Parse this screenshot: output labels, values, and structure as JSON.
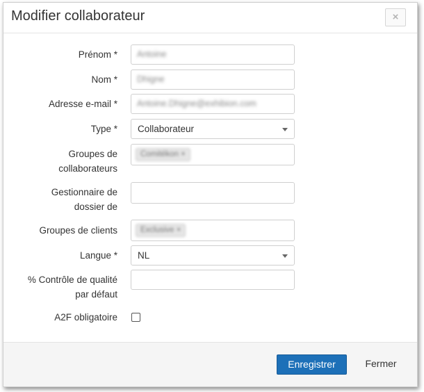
{
  "dialog": {
    "title": "Modifier collaborateur",
    "close_glyph": "×"
  },
  "form": {
    "first_name": {
      "label": "Prénom *",
      "value": "Antoine"
    },
    "last_name": {
      "label": "Nom *",
      "value": "Dhigne"
    },
    "email": {
      "label": "Adresse e-mail *",
      "value": "Antoine.Dhigne@exhibion.com"
    },
    "type": {
      "label": "Type *",
      "value": "Collaborateur"
    },
    "employee_groups": {
      "label_line1": "Groupes de",
      "label_line2": "collaborateurs",
      "tag": "Comitékon ×"
    },
    "file_manager": {
      "label_line1": "Gestionnaire de",
      "label_line2": "dossier de",
      "value": ""
    },
    "client_groups": {
      "label": "Groupes de clients",
      "tag": "Exclusive ×"
    },
    "language": {
      "label": "Langue *",
      "value": "NL"
    },
    "quality_control": {
      "label_line1": "% Contrôle de qualité",
      "label_line2": "par défaut",
      "value": ""
    },
    "two_factor": {
      "label": "A2F obligatoire",
      "checked": false
    }
  },
  "footer": {
    "save_label": "Enregistrer",
    "close_label": "Fermer"
  },
  "colors": {
    "primary_button": "#1d70b8",
    "footer_bg": "#f5f5f5"
  }
}
